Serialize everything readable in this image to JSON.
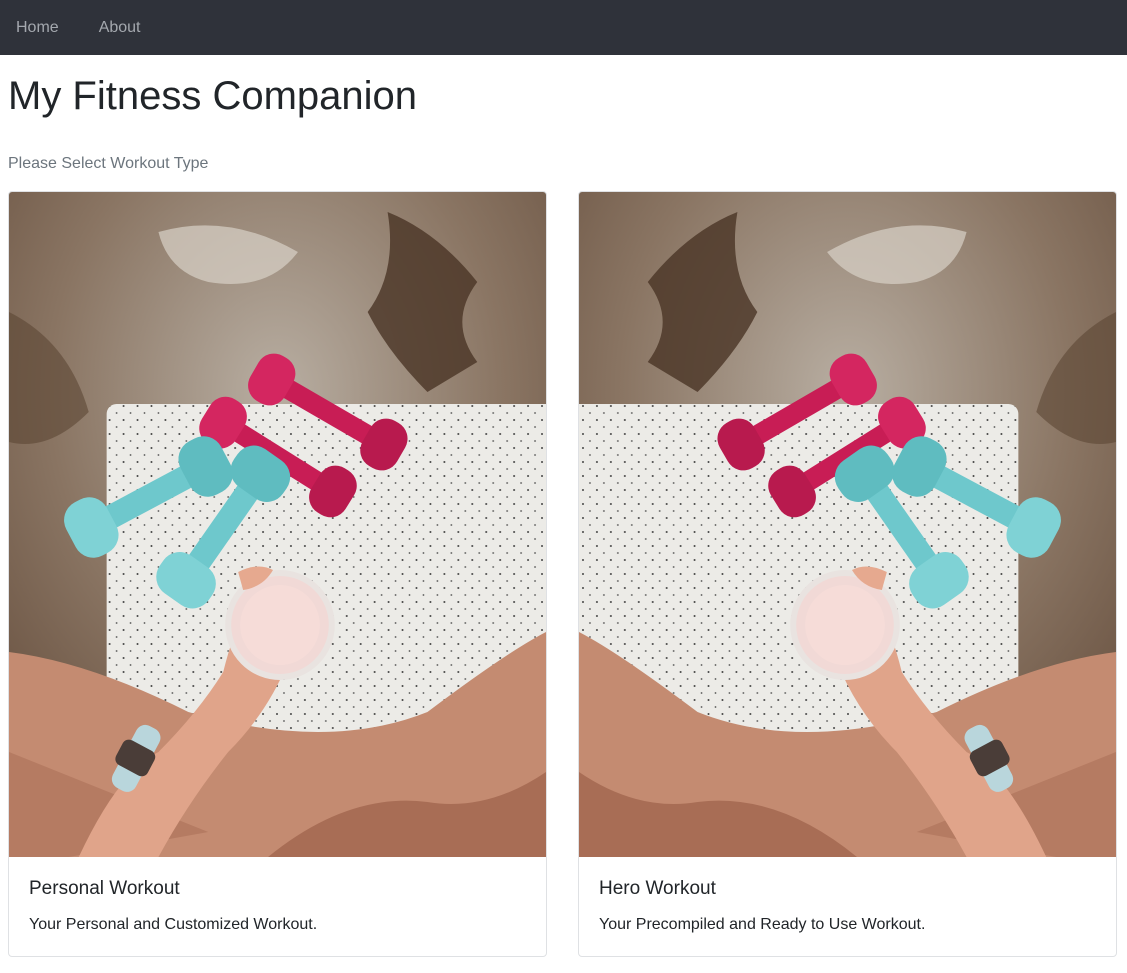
{
  "nav": {
    "items": [
      {
        "label": "Home"
      },
      {
        "label": "About"
      }
    ]
  },
  "page": {
    "title": "My Fitness Companion",
    "subtitle": "Please Select Workout Type"
  },
  "cards": [
    {
      "title": "Personal Workout",
      "text": "Your Personal and Customized Workout."
    },
    {
      "title": "Hero Workout",
      "text": "Your Precompiled and Ready to Use Workout."
    }
  ],
  "colors": {
    "navbar": "#2f323a",
    "nav_link": "#a4a8ae",
    "text_primary": "#212529",
    "text_muted": "#6c757d",
    "dumbbell_pink": "#c81d55",
    "dumbbell_teal": "#6ec8cc"
  }
}
